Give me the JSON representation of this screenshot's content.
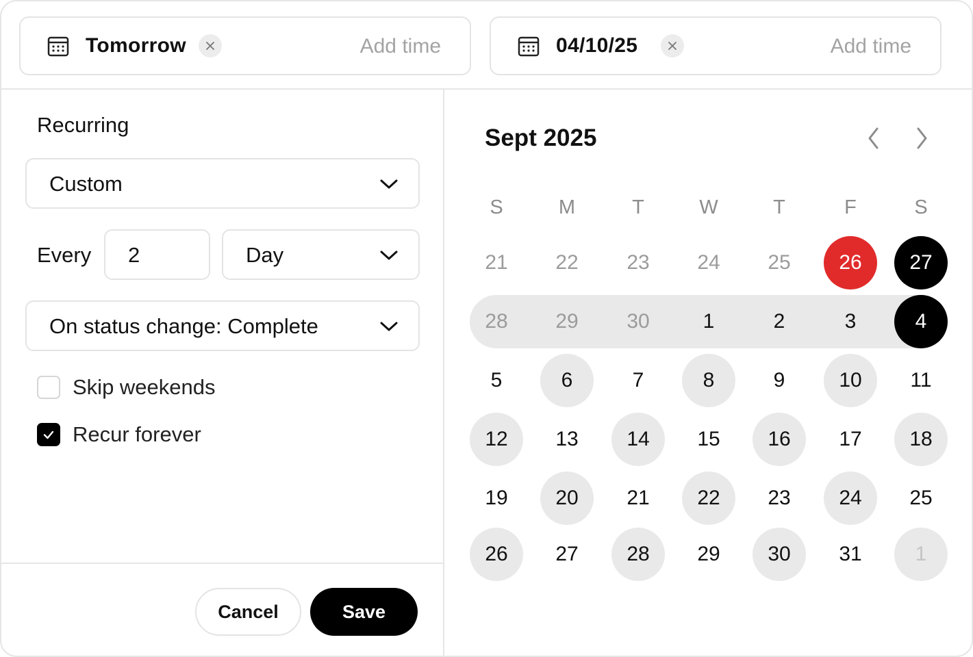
{
  "start_field": {
    "value": "Tomorrow",
    "add_time": "Add time"
  },
  "end_field": {
    "value": "04/10/25",
    "add_time": "Add time"
  },
  "recurring": {
    "label": "Recurring",
    "mode": "Custom",
    "every_label": "Every",
    "interval": "2",
    "unit": "Day",
    "trigger": "On status change: Complete",
    "skip_weekends": {
      "label": "Skip weekends",
      "checked": false
    },
    "recur_forever": {
      "label": "Recur forever",
      "checked": true
    }
  },
  "actions": {
    "cancel": "Cancel",
    "save": "Save"
  },
  "calendar": {
    "title": "Sept 2025",
    "weekdays": [
      "S",
      "M",
      "T",
      "W",
      "T",
      "F",
      "S"
    ],
    "weeks": [
      [
        {
          "d": "21",
          "s": "muted"
        },
        {
          "d": "22",
          "s": "muted"
        },
        {
          "d": "23",
          "s": "muted"
        },
        {
          "d": "24",
          "s": "muted"
        },
        {
          "d": "25",
          "s": "muted"
        },
        {
          "d": "26",
          "s": "today"
        },
        {
          "d": "27",
          "s": "selected"
        }
      ],
      [
        {
          "d": "28",
          "s": "muted"
        },
        {
          "d": "29",
          "s": "muted"
        },
        {
          "d": "30",
          "s": "muted"
        },
        {
          "d": "1",
          "s": "normal"
        },
        {
          "d": "2",
          "s": "normal"
        },
        {
          "d": "3",
          "s": "normal"
        },
        {
          "d": "4",
          "s": "selected"
        }
      ],
      [
        {
          "d": "5",
          "s": "normal"
        },
        {
          "d": "6",
          "s": "shaded"
        },
        {
          "d": "7",
          "s": "normal"
        },
        {
          "d": "8",
          "s": "shaded"
        },
        {
          "d": "9",
          "s": "normal"
        },
        {
          "d": "10",
          "s": "shaded"
        },
        {
          "d": "11",
          "s": "normal"
        }
      ],
      [
        {
          "d": "12",
          "s": "shaded"
        },
        {
          "d": "13",
          "s": "normal"
        },
        {
          "d": "14",
          "s": "shaded"
        },
        {
          "d": "15",
          "s": "normal"
        },
        {
          "d": "16",
          "s": "shaded"
        },
        {
          "d": "17",
          "s": "normal"
        },
        {
          "d": "18",
          "s": "shaded"
        }
      ],
      [
        {
          "d": "19",
          "s": "normal"
        },
        {
          "d": "20",
          "s": "shaded"
        },
        {
          "d": "21",
          "s": "normal"
        },
        {
          "d": "22",
          "s": "shaded"
        },
        {
          "d": "23",
          "s": "normal"
        },
        {
          "d": "24",
          "s": "shaded"
        },
        {
          "d": "25",
          "s": "normal"
        }
      ],
      [
        {
          "d": "26",
          "s": "shaded"
        },
        {
          "d": "27",
          "s": "normal"
        },
        {
          "d": "28",
          "s": "shaded"
        },
        {
          "d": "29",
          "s": "normal"
        },
        {
          "d": "30",
          "s": "shaded"
        },
        {
          "d": "31",
          "s": "normal"
        },
        {
          "d": "1",
          "s": "shaded-muted"
        }
      ]
    ],
    "band_week": 1
  },
  "colors": {
    "today": "#e12b2b",
    "selected": "#000000",
    "shaded": "#e9e9e9",
    "placeholder": "#a3a3a3",
    "border": "#e4e4e4"
  },
  "icons": {
    "calendar": "calendar-icon",
    "clear": "close-icon",
    "dropdown": "chevron-down-icon",
    "prev": "chevron-left-icon",
    "next": "chevron-right-icon",
    "check": "check-icon"
  }
}
